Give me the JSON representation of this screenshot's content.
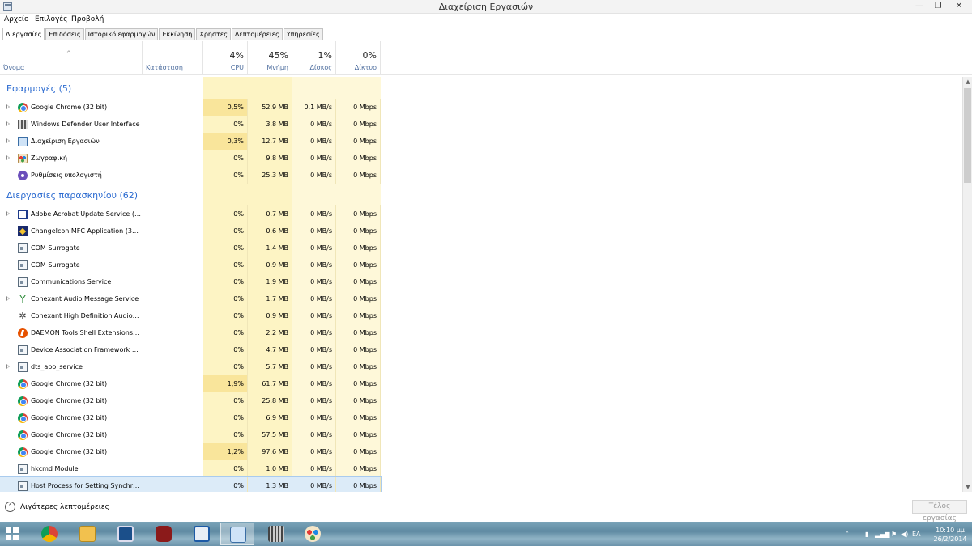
{
  "window": {
    "title": "Διαχείριση Εργασιών",
    "min": "—",
    "max": "❐",
    "close": "✕"
  },
  "menu": [
    "Αρχείο",
    "Επιλογές",
    "Προβολή"
  ],
  "tabs": [
    "Διεργασίες",
    "Επιδόσεις",
    "Ιστορικό εφαρμογών",
    "Εκκίνηση",
    "Χρήστες",
    "Λεπτομέρειες",
    "Υπηρεσίες"
  ],
  "header": {
    "sort_arrow": "^",
    "name": "Όνομα",
    "status": "Κατάσταση",
    "cpu_pct": "4%",
    "cpu": "CPU",
    "mem_pct": "45%",
    "mem": "Μνήμη",
    "disk_pct": "1%",
    "disk": "Δίσκος",
    "net_pct": "0%",
    "net": "Δίκτυο"
  },
  "groups": [
    {
      "title": "Εφαρμογές (5)",
      "rows": [
        {
          "name": "Google Chrome (32 bit)",
          "icon": "chrome-icon",
          "expand": true,
          "cpu": "0,5%",
          "mem": "52,9 MB",
          "disk": "0,1 MB/s",
          "net": "0 Mbps",
          "hot": true
        },
        {
          "name": "Windows Defender User Interface",
          "icon": "defender-icon",
          "expand": true,
          "cpu": "0%",
          "mem": "3,8 MB",
          "disk": "0 MB/s",
          "net": "0 Mbps"
        },
        {
          "name": "Διαχείριση Εργασιών",
          "icon": "task-manager-icon",
          "expand": true,
          "cpu": "0,3%",
          "mem": "12,7 MB",
          "disk": "0 MB/s",
          "net": "0 Mbps",
          "hot": true
        },
        {
          "name": "Ζωγραφική",
          "icon": "paint-icon",
          "expand": true,
          "cpu": "0%",
          "mem": "9,8 MB",
          "disk": "0 MB/s",
          "net": "0 Mbps"
        },
        {
          "name": "Ρυθμίσεις υπολογιστή",
          "icon": "pc-settings-icon",
          "expand": false,
          "cpu": "0%",
          "mem": "25,3 MB",
          "disk": "0 MB/s",
          "net": "0 Mbps"
        }
      ]
    },
    {
      "title": "Διεργασίες παρασκηνίου (62)",
      "rows": [
        {
          "name": "Adobe Acrobat Update Service (…",
          "icon": "window-icon",
          "expand": true,
          "cpu": "0%",
          "mem": "0,7 MB",
          "disk": "0 MB/s",
          "net": "0 Mbps"
        },
        {
          "name": "ChangeIcon MFC Application (3…",
          "icon": "app-icon",
          "expand": false,
          "cpu": "0%",
          "mem": "0,6 MB",
          "disk": "0 MB/s",
          "net": "0 Mbps"
        },
        {
          "name": "COM Surrogate",
          "icon": "process-icon",
          "expand": false,
          "cpu": "0%",
          "mem": "1,4 MB",
          "disk": "0 MB/s",
          "net": "0 Mbps"
        },
        {
          "name": "COM Surrogate",
          "icon": "process-icon",
          "expand": false,
          "cpu": "0%",
          "mem": "0,9 MB",
          "disk": "0 MB/s",
          "net": "0 Mbps"
        },
        {
          "name": "Communications Service",
          "icon": "process-icon",
          "expand": false,
          "cpu": "0%",
          "mem": "1,9 MB",
          "disk": "0 MB/s",
          "net": "0 Mbps"
        },
        {
          "name": "Conexant Audio Message Service",
          "icon": "conexant-icon",
          "expand": true,
          "cpu": "0%",
          "mem": "1,7 MB",
          "disk": "0 MB/s",
          "net": "0 Mbps"
        },
        {
          "name": "Conexant High Definition Audio…",
          "icon": "audio-icon",
          "expand": false,
          "cpu": "0%",
          "mem": "0,9 MB",
          "disk": "0 MB/s",
          "net": "0 Mbps"
        },
        {
          "name": "DAEMON Tools Shell Extensions…",
          "icon": "daemon-icon",
          "expand": false,
          "cpu": "0%",
          "mem": "2,2 MB",
          "disk": "0 MB/s",
          "net": "0 Mbps"
        },
        {
          "name": "Device Association Framework …",
          "icon": "process-icon",
          "expand": false,
          "cpu": "0%",
          "mem": "4,7 MB",
          "disk": "0 MB/s",
          "net": "0 Mbps"
        },
        {
          "name": "dts_apo_service",
          "icon": "process-icon",
          "expand": true,
          "cpu": "0%",
          "mem": "5,7 MB",
          "disk": "0 MB/s",
          "net": "0 Mbps"
        },
        {
          "name": "Google Chrome (32 bit)",
          "icon": "chrome-icon",
          "expand": false,
          "cpu": "1,9%",
          "mem": "61,7 MB",
          "disk": "0 MB/s",
          "net": "0 Mbps",
          "hot": true
        },
        {
          "name": "Google Chrome (32 bit)",
          "icon": "chrome-icon",
          "expand": false,
          "cpu": "0%",
          "mem": "25,8 MB",
          "disk": "0 MB/s",
          "net": "0 Mbps"
        },
        {
          "name": "Google Chrome (32 bit)",
          "icon": "chrome-icon",
          "expand": false,
          "cpu": "0%",
          "mem": "6,9 MB",
          "disk": "0 MB/s",
          "net": "0 Mbps"
        },
        {
          "name": "Google Chrome (32 bit)",
          "icon": "chrome-icon",
          "expand": false,
          "cpu": "0%",
          "mem": "57,5 MB",
          "disk": "0 MB/s",
          "net": "0 Mbps"
        },
        {
          "name": "Google Chrome (32 bit)",
          "icon": "chrome-icon",
          "expand": false,
          "cpu": "1,2%",
          "mem": "97,6 MB",
          "disk": "0 MB/s",
          "net": "0 Mbps",
          "hot": true
        },
        {
          "name": "hkcmd Module",
          "icon": "process-icon",
          "expand": false,
          "cpu": "0%",
          "mem": "1,0 MB",
          "disk": "0 MB/s",
          "net": "0 Mbps"
        },
        {
          "name": "Host Process for Setting Synchr…",
          "icon": "process-icon",
          "expand": false,
          "cpu": "0%",
          "mem": "1,3 MB",
          "disk": "0 MB/s",
          "net": "0 Mbps",
          "selected": true
        }
      ]
    }
  ],
  "footer": {
    "fewer_details": "Λιγότερες λεπτομέρειες",
    "end_task": "Τέλος εργασίας",
    "chevron": "˄"
  },
  "taskbar": {
    "apps": [
      "chrome-icon",
      "file-explorer-icon",
      "remote-desktop-icon",
      "acrobat-icon",
      "tools-icon",
      "task-manager-icon",
      "settings-icon",
      "paint-icon"
    ],
    "language": "ΕΛ",
    "time": "10:10 μμ",
    "date": "26/2/2014"
  },
  "colors": {
    "cpu_hot": "#f9e59b",
    "cpu_col": "#fdf4c4",
    "mem_col": "#fdf4c4",
    "disk_col": "#fef8d9",
    "net_col": "#fef8d9",
    "accent_blue": "#2a6ad0"
  }
}
